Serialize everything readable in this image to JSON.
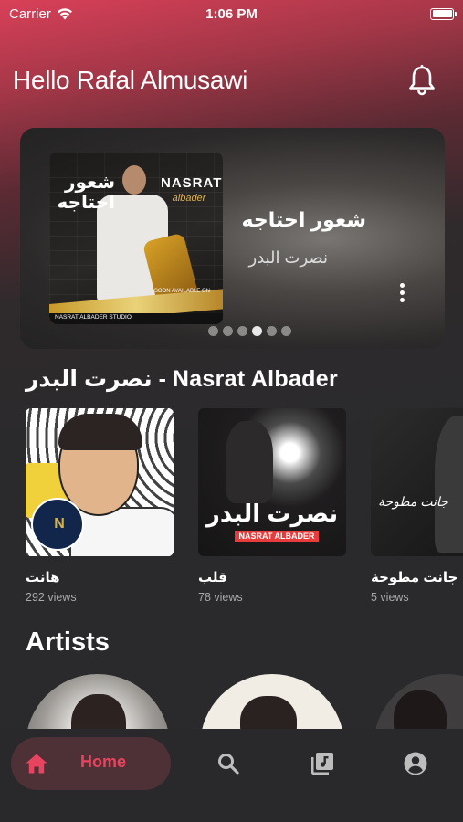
{
  "status_bar": {
    "carrier": "Carrier",
    "time": "1:06 PM"
  },
  "header": {
    "greeting": "Hello Rafal Almusawi",
    "icon": "bell-icon"
  },
  "hero": {
    "title": "شعور احتاجه",
    "artist": "نصرت البدر",
    "cover": {
      "ar_title": "شعور احتاجه",
      "en_title": "NASRAT",
      "en_sub": "albader",
      "footer": "NASRAT ALBADER STUDIO",
      "badge": "SOON AVAILABLE ON"
    },
    "page_count": 6,
    "active_page": 3
  },
  "section": {
    "title": "نصرت البدر - Nasrat Albader"
  },
  "songs": [
    {
      "name": "هانت",
      "views": "292 views"
    },
    {
      "name": "قلب",
      "views": "78 views",
      "cover_ar": "نصرت البدر",
      "cover_en": "NASRAT ALBADER"
    },
    {
      "name": "جانت مطوحة",
      "views": "5 views",
      "cover_title": "جانت مطوحة"
    }
  ],
  "artists": {
    "title": "Artists"
  },
  "bottom_nav": {
    "home_label": "Home",
    "items": [
      "home-icon",
      "search-icon",
      "library-music-icon",
      "account-circle-icon"
    ]
  },
  "colors": {
    "accent": "#e8445f",
    "background": "#2a2a2c",
    "nav_active_bg": "#4e3136"
  }
}
